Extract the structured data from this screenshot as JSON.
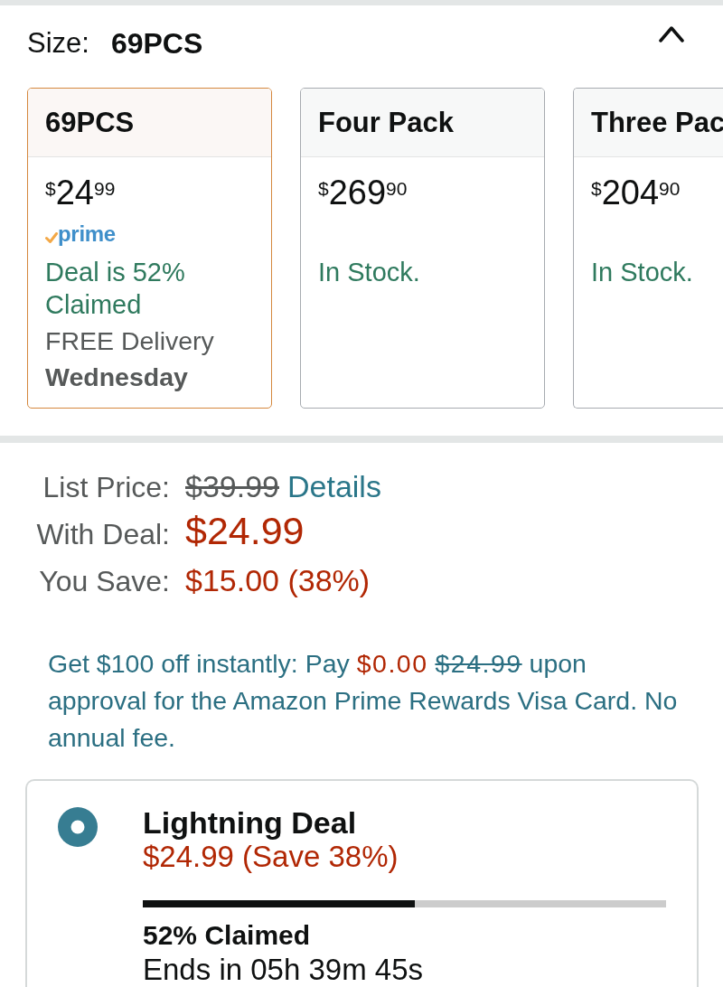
{
  "size_selector": {
    "label": "Size:",
    "value": "69PCS",
    "expanded": true
  },
  "options": [
    {
      "name": "69PCS",
      "selected": true,
      "price": {
        "symbol": "$",
        "whole": "24",
        "fraction": "99"
      },
      "prime_badge": "prime",
      "status": "Deal is 52% Claimed",
      "delivery": "FREE Delivery **Wednesday**"
    },
    {
      "name": "Four Pack",
      "selected": false,
      "price": {
        "symbol": "$",
        "whole": "269",
        "fraction": "90"
      },
      "status": "In Stock."
    },
    {
      "name": "Three Pac",
      "selected": false,
      "price": {
        "symbol": "$",
        "whole": "204",
        "fraction": "90"
      },
      "status": "In Stock."
    }
  ],
  "pricing": [
    {
      "kind": "list",
      "label": "List Price:",
      "value": "$39.99",
      "link": "Details"
    },
    {
      "kind": "deal",
      "label": "With Deal:",
      "value": "$24.99"
    },
    {
      "kind": "save",
      "label": "You Save:",
      "value": "$15.00 (38%)"
    }
  ],
  "card_offer": [
    {
      "kind": "text",
      "text": "Get $100 off instantly: Pay"
    },
    {
      "kind": "price",
      "text": "$0.00"
    },
    {
      "kind": "strike",
      "text": "$24.99"
    },
    {
      "kind": "text",
      "text": "upon approval for the Amazon Prime Rewards Visa Card. No annual fee."
    }
  ],
  "lightning_deal": {
    "selected": true,
    "title": "Lightning Deal",
    "price": "$24.99 (Save 38%)",
    "level": 0.52,
    "claimed": "52% Claimed",
    "ends": "Ends in 05h 39m 45s"
  }
}
